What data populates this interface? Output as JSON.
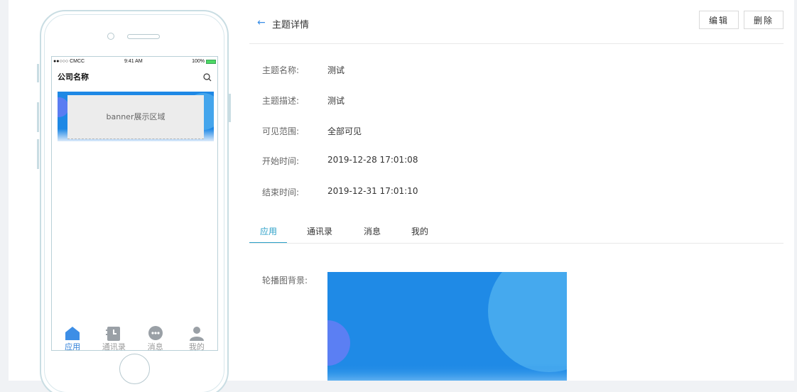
{
  "phone": {
    "status": {
      "carrier": "●●○○○ CMCC",
      "time": "9:41 AM",
      "battery": "100%"
    },
    "company_name": "公司名称",
    "banner_text": "banner展示区域",
    "tabs": [
      {
        "label": "应用",
        "icon": "home-icon",
        "active": true
      },
      {
        "label": "通讯录",
        "icon": "contacts-icon",
        "active": false
      },
      {
        "label": "消息",
        "icon": "message-icon",
        "active": false
      },
      {
        "label": "我的",
        "icon": "user-icon",
        "active": false
      }
    ]
  },
  "detail": {
    "back_icon": "←",
    "title": "主题详情",
    "edit_label": "编辑",
    "delete_label": "删除",
    "fields": [
      {
        "label": "主题名称:",
        "value": "测试"
      },
      {
        "label": "主题描述:",
        "value": "测试"
      },
      {
        "label": "可见范围:",
        "value": "全部可见"
      },
      {
        "label": "开始时间:",
        "value": "2019-12-28 17:01:08"
      },
      {
        "label": "结束时间:",
        "value": "2019-12-31 17:01:10"
      }
    ],
    "tabs": [
      "应用",
      "通讯录",
      "消息",
      "我的"
    ],
    "active_tab": "应用",
    "banner_bg_label": "轮播图背景:"
  },
  "colors": {
    "accent": "#2ba0c8",
    "banner_blue": "#1f8ae6"
  }
}
